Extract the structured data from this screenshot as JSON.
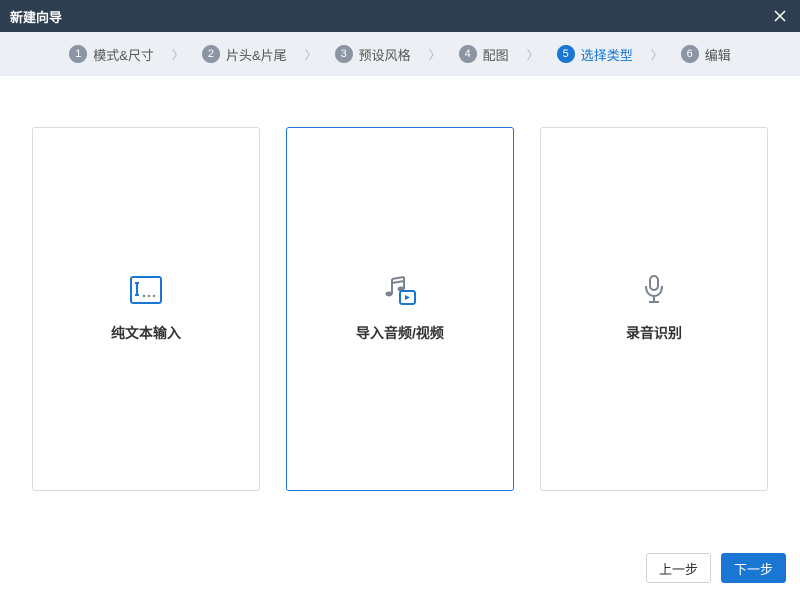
{
  "titlebar": {
    "title": "新建向导"
  },
  "steps": [
    {
      "num": "1",
      "label": "模式&尺寸",
      "active": false
    },
    {
      "num": "2",
      "label": "片头&片尾",
      "active": false
    },
    {
      "num": "3",
      "label": "预设风格",
      "active": false
    },
    {
      "num": "4",
      "label": "配图",
      "active": false
    },
    {
      "num": "5",
      "label": "选择类型",
      "active": true
    },
    {
      "num": "6",
      "label": "编辑",
      "active": false
    }
  ],
  "cards": [
    {
      "id": "text-input",
      "label": "纯文本输入",
      "selected": false,
      "icon": "text-box-icon"
    },
    {
      "id": "import-av",
      "label": "导入音频/视频",
      "selected": true,
      "icon": "music-video-icon"
    },
    {
      "id": "voice-record",
      "label": "录音识别",
      "selected": false,
      "icon": "microphone-icon"
    }
  ],
  "footer": {
    "prev": "上一步",
    "next": "下一步"
  },
  "colors": {
    "accent": "#1976D2",
    "titlebar": "#2C3E50",
    "stepbar": "#ECEFF3"
  }
}
